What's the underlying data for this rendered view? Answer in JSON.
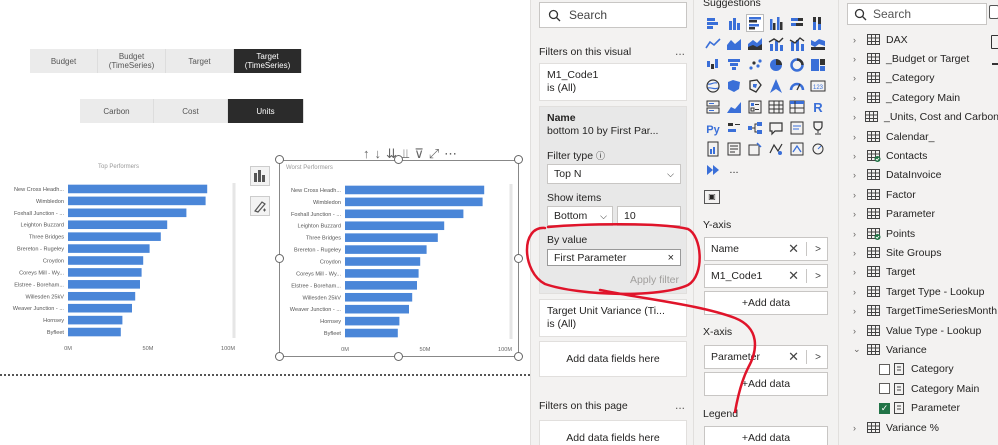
{
  "toggles": {
    "row1": [
      "Budget",
      "Budget\n(TimeSeries)",
      "Target",
      "Target\n(TimeSeries)"
    ],
    "row1_selected": 3,
    "row2": [
      "Carbon",
      "Cost",
      "Units"
    ],
    "row2_selected": 2
  },
  "charts": {
    "top": {
      "title": "Top Performers"
    },
    "worst": {
      "title": "Worst Performers"
    }
  },
  "chart_data": [
    {
      "type": "bar",
      "title": "Top Performers",
      "orientation": "horizontal",
      "categories": [
        "New Cross Headh...",
        "Wimbledon",
        "Foxhall Junction - ...",
        "Leighton Buzzard",
        "Three Bridges",
        "Brereton - Rugeley",
        "Croydon",
        "Coreys Mill - Wy...",
        "Elstree - Boreham...",
        "Willesden 25kV",
        "Weaver Junction - ...",
        "Hornsey",
        "Byfleet"
      ],
      "values": [
        87,
        86,
        74,
        62,
        58,
        51,
        47,
        46,
        45,
        42,
        40,
        34,
        33
      ],
      "xticks": [
        "0M",
        "50M",
        "100M"
      ],
      "xlim": [
        0,
        100
      ]
    },
    {
      "type": "bar",
      "title": "Worst Performers",
      "orientation": "horizontal",
      "categories": [
        "New Cross Headh...",
        "Wimbledon",
        "Foxhall Junction - ...",
        "Leighton Buzzard",
        "Three Bridges",
        "Brereton - Rugeley",
        "Croydon",
        "Coreys Mill - Wy...",
        "Elstree - Boreham...",
        "Willesden 25kV",
        "Weaver Junction - ...",
        "Hornsey",
        "Byfleet"
      ],
      "values": [
        87,
        86,
        74,
        62,
        58,
        51,
        47,
        46,
        45,
        42,
        40,
        34,
        33
      ],
      "xticks": [
        "0M",
        "50M",
        "100M"
      ],
      "xlim": [
        0,
        100
      ]
    }
  ],
  "filters": {
    "search_placeholder": "Search",
    "on_visual_header": "Filters on this visual",
    "more": "...",
    "m1_name": "M1_Code1",
    "m1_state": "is (All)",
    "name_title": "Name",
    "name_state": "bottom 10 by First Par...",
    "filter_type_label": "Filter type",
    "filter_type_value": "Top N",
    "show_items_label": "Show items",
    "show_items_dir": "Bottom",
    "show_items_count": "10",
    "by_value_label": "By value",
    "by_value_field": "First Parameter",
    "apply_label": "Apply filter",
    "target_var_name": "Target Unit Variance (Ti...",
    "target_var_state": "is (All)",
    "add_fields": "Add data fields here",
    "on_page_header": "Filters on this page",
    "add_fields_2": "Add data fields here"
  },
  "viz": {
    "suggestions": "Suggestions",
    "more_icons": "...",
    "yaxis": "Y-axis",
    "y_fields": [
      "Name",
      "M1_Code1"
    ],
    "add_data": "+Add data",
    "xaxis": "X-axis",
    "x_fields": [
      "Parameter"
    ],
    "legend": "Legend",
    "add_data_legend": "+Add data"
  },
  "data_pane": {
    "search_placeholder": "Search",
    "tables": [
      "DAX",
      "_Budget or Target",
      "_Category",
      "_Category Main",
      "_Units, Cost and Carbon",
      "Calendar_",
      "Contacts",
      "DataInvoice",
      "Factor",
      "Parameter",
      "Points",
      "Site Groups",
      "Target",
      "Target Type - Lookup",
      "TargetTimeSeriesMonth",
      "Value Type - Lookup",
      "Variance"
    ],
    "variance_children": [
      "Category",
      "Category Main",
      "Parameter"
    ],
    "last": "Variance %"
  },
  "colors": {
    "bar": "#4a86d8",
    "selected_toggle": "#2b2b2b",
    "annotation": "#e0142a",
    "check": "#217346"
  }
}
